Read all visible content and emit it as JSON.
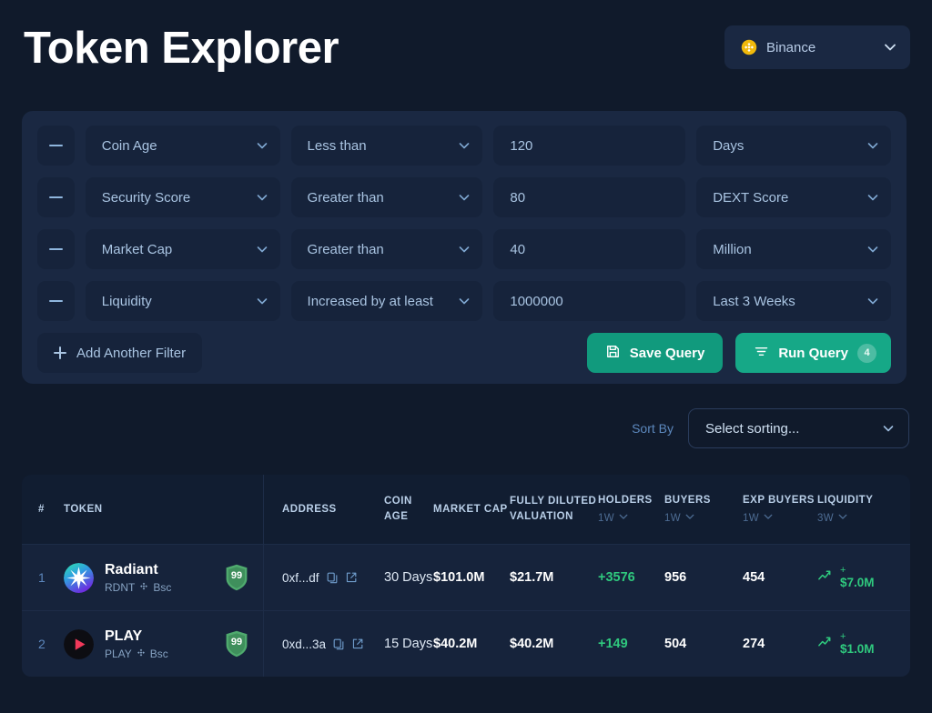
{
  "header": {
    "title": "Token Explorer",
    "chain_select": {
      "label": "Binance",
      "icon": "binance-icon",
      "chevron": "chevron-down-icon"
    }
  },
  "filters": {
    "remove_icon": "minus-icon",
    "rows": [
      {
        "field": "Coin Age",
        "operator": "Less than",
        "value": "120",
        "unit": "Days"
      },
      {
        "field": "Security Score",
        "operator": "Greater than",
        "value": "80",
        "unit": "DEXT Score"
      },
      {
        "field": "Market Cap",
        "operator": "Greater than",
        "value": "40",
        "unit": "Million"
      },
      {
        "field": "Liquidity",
        "operator": "Increased by at least",
        "value": "1000000",
        "unit": "Last 3 Weeks"
      }
    ],
    "add_filter_label": "Add Another Filter",
    "add_filter_icon": "plus-icon",
    "save_label": "Save Query",
    "save_icon": "save-disk-icon",
    "run_label": "Run Query",
    "run_icon": "filter-icon",
    "run_badge": "4"
  },
  "sort": {
    "label": "Sort By",
    "selected": "Select sorting...",
    "chevron": "chevron-down-icon"
  },
  "table": {
    "columns": {
      "rank": "#",
      "token": "TOKEN",
      "address": "ADDRESS",
      "coin_age": "COIN AGE",
      "market_cap": "MARKET CAP",
      "fdv": "FULLY DILUTED VALUATION",
      "holders": "HOLDERS",
      "holders_period": "1W",
      "buyers": "BUYERS",
      "buyers_period": "1W",
      "exp_buyers": "EXP BUYERS",
      "exp_buyers_period": "1W",
      "liquidity": "LIQUIDITY",
      "liquidity_period": "3W"
    },
    "rows": [
      {
        "rank": "1",
        "name": "Radiant",
        "symbol": "RDNT",
        "chain": "Bsc",
        "score": "99",
        "address": "0xf...df",
        "coin_age": "30 Days",
        "market_cap": "$101.0M",
        "fdv": "$21.7M",
        "holders": "+3576",
        "buyers": "956",
        "exp_buyers": "454",
        "liquidity_sign": "+",
        "liquidity": "$7.0M"
      },
      {
        "rank": "2",
        "name": "PLAY",
        "symbol": "PLAY",
        "chain": "Bsc",
        "score": "99",
        "address": "0xd...3a",
        "coin_age": "15 Days",
        "market_cap": "$40.2M",
        "fdv": "$40.2M",
        "holders": "+149",
        "buyers": "504",
        "exp_buyers": "274",
        "liquidity_sign": "+",
        "liquidity": "$1.0M"
      }
    ],
    "icons": {
      "copy": "copy-icon",
      "external": "external-link-icon",
      "trend": "trend-up-icon",
      "shield": "shield-score-icon",
      "chain": "bsc-chain-icon"
    }
  },
  "colors": {
    "background": "#101a2b",
    "panel": "#1a2842",
    "field": "#16233b",
    "accent_green": "#16a887",
    "positive": "#2fc97e"
  }
}
